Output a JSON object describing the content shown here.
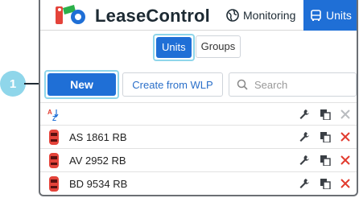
{
  "callout": {
    "number": "1"
  },
  "header": {
    "title": "LeaseControl",
    "nav": {
      "monitoring": "Monitoring",
      "units": "Units"
    }
  },
  "tabs": {
    "units": "Units",
    "groups": "Groups"
  },
  "toolbar": {
    "new_label": "New",
    "wlp_label": "Create from WLP",
    "search_placeholder": "Search"
  },
  "rows": [
    {
      "name": "AS 1861 RB"
    },
    {
      "name": "AV 2952 RB"
    },
    {
      "name": "BD 9534 RB"
    }
  ],
  "colors": {
    "accent": "#1f6fd6",
    "highlight": "#8fd6ea",
    "delete": "#e23b2e"
  }
}
